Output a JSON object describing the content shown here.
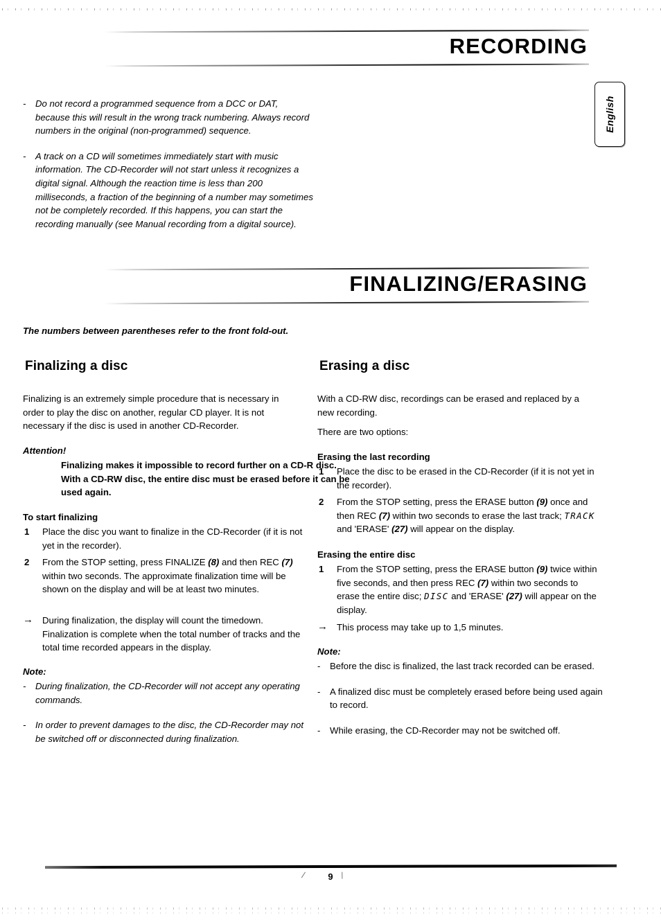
{
  "page": {
    "number": "9",
    "language_tab": "English"
  },
  "sections": [
    {
      "id": "recording",
      "title": "RECORDING",
      "notes": [
        "Do not record a programmed sequence from a DCC or DAT, because this will result in the wrong track numbering. Always record numbers in the original (non-programmed) sequence.",
        "A track on a CD will sometimes immediately start with music information. The CD-Recorder will not start unless it recognizes a digital signal. Although the reaction time is less than 200 milliseconds, a fraction of the beginning of a number may sometimes not be completely recorded. If this happens, you can start the recording manually (see Manual recording from a digital source)."
      ]
    },
    {
      "id": "finalizing-erasing",
      "title": "FINALIZING/ERASING",
      "intro": "The numbers between parentheses refer to the front fold-out."
    }
  ],
  "left_column": {
    "heading": "Finalizing a disc",
    "intro": "Finalizing is an extremely simple procedure that is necessary in order to play the disc on another, regular CD player. It is not necessary if the disc is used in another CD-Recorder.",
    "attention_label": "Attention!",
    "attention_text": "Finalizing makes it impossible to record further on a CD-R disc. With a CD-RW disc, the entire disc must be erased before it can be used again.",
    "start_heading": "To start finalizing",
    "steps": [
      {
        "number": "1",
        "text": "Place the disc you want to finalize in the CD-Recorder (if it is not yet in the recorder)."
      },
      {
        "number": "2",
        "text_1": "From the STOP setting, press FINALIZE",
        "ref_1": "(8)",
        "text_2": "and then REC",
        "ref_2": "(7)",
        "text_3": "within two seconds.",
        "text_4": "The approximate finalization time will be shown on the display and will be at least two minutes."
      }
    ],
    "arrow_marker": "→",
    "arrow_text": "During finalization, the display will count the timedown. Finalization is complete when the total number of tracks and the total time recorded appears in the display.",
    "note_label": "Note:",
    "note_items": [
      "During finalization, the CD-Recorder will not accept any operating commands.",
      "In order to prevent damages to the disc, the CD-Recorder may not be switched off or disconnected during finalization."
    ]
  },
  "right_column": {
    "heading": "Erasing a disc",
    "intro": "With a CD-RW disc, recordings can be erased and replaced by a new recording.",
    "options_line": "There are two options:",
    "last_recording": {
      "heading": "Erasing the last recording",
      "step_1_number": "1",
      "step_1_text": "Place the disc to be erased in the CD-Recorder (if it is not yet in the recorder).",
      "step_2_number": "2",
      "step_2_text_1": "From the STOP setting, press the ERASE button",
      "step_2_ref_1": "(9)",
      "step_2_text_2": "once and then REC",
      "step_2_ref_2": "(7)",
      "step_2_text_3": "within two seconds to erase the last track;",
      "step_2_lcd": "TRACK",
      "step_2_text_4": "and 'ERASE'",
      "step_2_ref_3": "(27)",
      "step_2_text_5": "will appear on the display."
    },
    "entire_disc": {
      "heading": "Erasing the entire disc",
      "step_1_number": "1",
      "step_1_text_1": "From the STOP setting, press the ERASE button",
      "step_1_ref_1": "(9)",
      "step_1_text_2": "twice within five seconds, and then press REC",
      "step_1_ref_2": "(7)",
      "step_1_text_3": "within two seconds to erase the entire disc;",
      "step_1_lcd": "DISC",
      "step_1_text_4": "and 'ERASE'",
      "step_1_ref_3": "(27)",
      "step_1_text_5": "will appear on the display.",
      "arrow_marker": "→",
      "arrow_text": "This process may take up to 1,5 minutes."
    },
    "note_label": "Note:",
    "note_items": [
      "Before the disc is finalized, the last track recorded can be erased.",
      "A finalized disc must be completely erased before being used again to record.",
      "While erasing, the CD-Recorder may not be switched off."
    ]
  },
  "markers": {
    "dash": "-"
  }
}
